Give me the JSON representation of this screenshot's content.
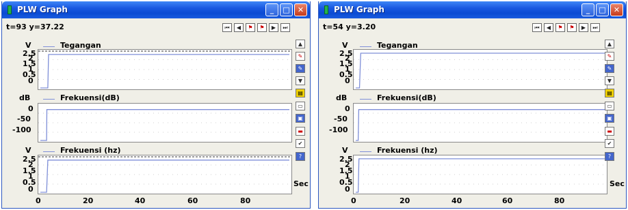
{
  "windows": [
    {
      "title": "PLW Graph",
      "status": "t=93 y=37.22",
      "plots": [
        {
          "unit": "V",
          "legend": "Tegangan",
          "yticks": [
            "2.5",
            "2",
            "1.5",
            "1",
            "0.5",
            "0"
          ],
          "ymin": 0,
          "ymax": 2.7,
          "dashed_top": true,
          "series": {
            "x": [
              0,
              2,
              3,
              3.3,
              100
            ],
            "y": [
              0,
              0,
              0,
              2.5,
              2.5
            ]
          }
        },
        {
          "unit": "dB",
          "legend": "Frekuensi(dB)",
          "yticks": [
            "0",
            "-50",
            "-100"
          ],
          "ymin": -120,
          "ymax": 15,
          "dashed_top": false,
          "series": {
            "x": [
              0,
              2,
              2.5,
              2.6,
              100
            ],
            "y": [
              -120,
              -120,
              -120,
              0,
              0
            ]
          }
        },
        {
          "unit": "V",
          "legend": "Frekuensi (hz)",
          "yticks": [
            "2.5",
            "2",
            "1.5",
            "1",
            "0.5",
            "0"
          ],
          "ymin": 0,
          "ymax": 2.7,
          "dashed_top": true,
          "series": {
            "x": [
              0,
              1.5,
              2.5,
              3,
              100
            ],
            "y": [
              0,
              0,
              0,
              2.5,
              2.5
            ]
          }
        }
      ],
      "xticks": [
        "0",
        "20",
        "40",
        "60",
        "80"
      ],
      "x_unit": "Sec"
    },
    {
      "title": "PLW Graph",
      "status": "t=54 y=3.20",
      "plots": [
        {
          "unit": "V",
          "legend": "Tegangan",
          "yticks": [
            "2.5",
            "2",
            "1.5",
            "1",
            "0.5",
            "0"
          ],
          "ymin": 0,
          "ymax": 2.7,
          "dashed_top": false,
          "series": {
            "x": [
              0,
              0.5,
              1.5,
              2,
              100
            ],
            "y": [
              0,
              0,
              0,
              2.6,
              2.6
            ]
          }
        },
        {
          "unit": "dB",
          "legend": "Frekuensi(dB)",
          "yticks": [
            "0",
            "-50",
            "-100"
          ],
          "ymin": -120,
          "ymax": 15,
          "dashed_top": false,
          "series": {
            "x": [
              0,
              0.5,
              1,
              1.2,
              100
            ],
            "y": [
              -120,
              -120,
              -120,
              0,
              0
            ]
          }
        },
        {
          "unit": "V",
          "legend": "Frekuensi (hz)",
          "yticks": [
            "2.5",
            "2",
            "1.5",
            "1",
            "0.5",
            "0"
          ],
          "ymin": 0,
          "ymax": 2.7,
          "dashed_top": false,
          "series": {
            "x": [
              0,
              0.5,
              1,
              1.3,
              100
            ],
            "y": [
              0,
              0,
              0,
              2.6,
              2.6
            ]
          }
        }
      ],
      "xticks": [
        "0",
        "20",
        "40",
        "60",
        "80"
      ],
      "x_unit": "Sec"
    }
  ],
  "toolbar_buttons": [
    "first",
    "previous",
    "mark-start",
    "mark-end",
    "next",
    "last"
  ],
  "toolbar_glyphs": [
    "⏮",
    "◀",
    "⚑",
    "⚑",
    "▶",
    "⏭"
  ],
  "side_buttons": [
    "scroll-up",
    "pen-red",
    "pen-blue",
    "scroll-down",
    "note",
    "monitor",
    "save",
    "delete",
    "check",
    "help"
  ],
  "side_glyphs": [
    "▲",
    "✎",
    "✎",
    "▼",
    "▤",
    "▭",
    "▣",
    "▬",
    "✔",
    "?"
  ],
  "colors": {
    "series": "#7f8fd8",
    "plot_bg": "#ffffff",
    "window_bg": "#f0efe7",
    "titlebar": "#1958e0"
  }
}
